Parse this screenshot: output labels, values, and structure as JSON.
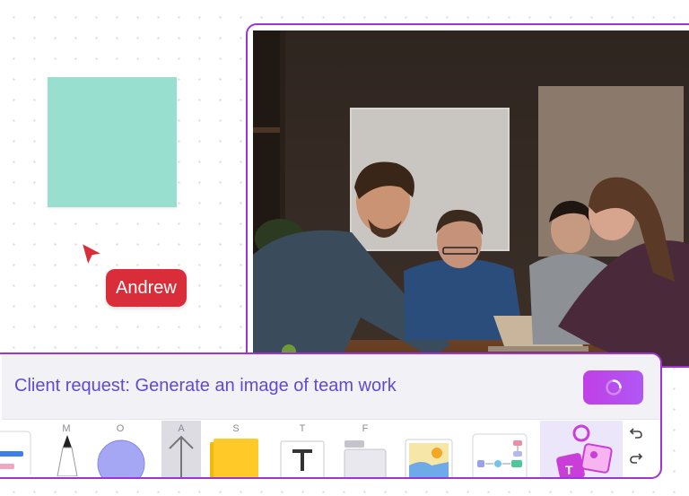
{
  "canvas": {
    "sticky_note_color": "#98dfd0",
    "collaborator": {
      "name": "Andrew",
      "color": "#d92d3a"
    },
    "selection_color": "#9b35d6"
  },
  "prompt": {
    "text": "Client request: Generate an image of team work",
    "button_icon": "spinner-icon",
    "text_color": "#5f4bd3"
  },
  "toolbar": {
    "items": [
      {
        "icon": "shapes-card-icon",
        "key": ""
      },
      {
        "icon": "marker-icon",
        "key": "M"
      },
      {
        "icon": "circle-icon",
        "key": "O"
      },
      {
        "icon": "arrow-up-icon",
        "key": "A"
      },
      {
        "icon": "sticky-note-icon",
        "key": "S"
      },
      {
        "icon": "text-icon",
        "key": "T"
      },
      {
        "icon": "frame-icon",
        "key": "F"
      },
      {
        "icon": "image-icon",
        "key": ""
      },
      {
        "icon": "flowchart-icon",
        "key": ""
      },
      {
        "icon": "ai-generate-icon",
        "key": ""
      }
    ],
    "undo_icon": "undo-icon",
    "redo_icon": "redo-icon"
  }
}
